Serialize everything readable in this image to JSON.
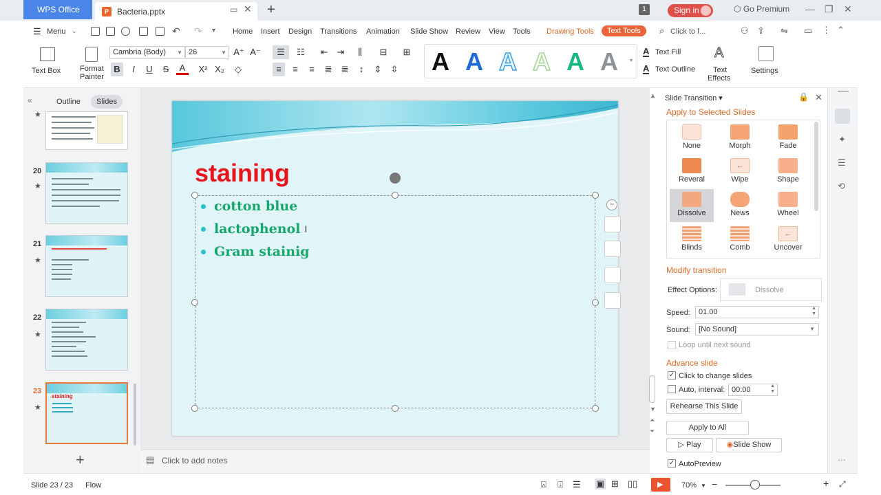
{
  "titlebar": {
    "app_tab": "WPS Office",
    "doc_tab": "Bacteria.pptx",
    "badge": "1",
    "sign_in": "Sign in",
    "go_premium": "Go Premium"
  },
  "menu": {
    "menu_label": "Menu",
    "items": [
      "Home",
      "Insert",
      "Design",
      "Transitions",
      "Animation",
      "Slide Show",
      "Review",
      "View",
      "Tools"
    ],
    "context_drawing": "Drawing Tools",
    "context_text": "Text Tools",
    "search_placeholder": "Click to f..."
  },
  "ribbon": {
    "text_box": "Text Box",
    "format_painter_1": "Format",
    "format_painter_2": "Painter",
    "font_name": "Cambria (Body)",
    "font_size": "26",
    "wordart_letter": "A",
    "text_fill": "Text Fill",
    "text_outline": "Text Outline",
    "text_effects_1": "Text",
    "text_effects_2": "Effects",
    "settings": "Settings"
  },
  "left_panel": {
    "tabs": [
      "Outline",
      "Slides"
    ],
    "active_tab": "Slides",
    "slides": [
      {
        "num": "20"
      },
      {
        "num": "21"
      },
      {
        "num": "22"
      },
      {
        "num": "23",
        "title": "staining"
      }
    ]
  },
  "slide": {
    "title": "staining",
    "bullets": [
      "cotton blue",
      "lactophenol",
      "Gram stainig"
    ],
    "notes_placeholder": "Click to add notes"
  },
  "transition_pane": {
    "title": "Slide Transition",
    "apply_selected": "Apply to Selected Slides",
    "effects": [
      {
        "name": "None"
      },
      {
        "name": "Morph"
      },
      {
        "name": "Fade"
      },
      {
        "name": "Reveral"
      },
      {
        "name": "Wipe"
      },
      {
        "name": "Shape"
      },
      {
        "name": "Dissolve"
      },
      {
        "name": "News"
      },
      {
        "name": "Wheel"
      },
      {
        "name": "Blinds"
      },
      {
        "name": "Comb"
      },
      {
        "name": "Uncover"
      }
    ],
    "selected_effect": "Dissolve",
    "modify": "Modify transition",
    "effect_options_label": "Effect Options:",
    "effect_options_value": "Dissolve",
    "speed_label": "Speed:",
    "speed_value": "01.00",
    "sound_label": "Sound:",
    "sound_value": "[No Sound]",
    "loop_label": "Loop until next sound",
    "advance": "Advance slide",
    "click_change": "Click to change slides",
    "auto_interval": "Auto, interval:",
    "interval_value": "00:00",
    "rehearse": "Rehearse This Slide",
    "apply_all": "Apply to All",
    "play": "Play",
    "slide_show": "Slide Show",
    "autopreview": "AutoPreview"
  },
  "status": {
    "slide_count": "Slide 23 / 23",
    "flow": "Flow",
    "zoom": "70%"
  },
  "colors": {
    "accent": "#e9643a",
    "title_red": "#e8141c",
    "bullet_green": "#15a86a"
  }
}
